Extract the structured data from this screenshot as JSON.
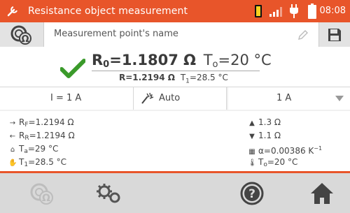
{
  "header": {
    "title": "Resistance object measurement",
    "time": "08:08",
    "accent": "#e8552a"
  },
  "name_bar": {
    "placeholder": "Measurement point's name"
  },
  "result": {
    "r0_symbol": "R",
    "r0_sub": "0",
    "r0_value": "=1.1807 Ω",
    "t0_symbol": "T",
    "t0_sub": "o",
    "t0_value": "=20 °C",
    "r_text": "R=1.2194 Ω",
    "t1_symbol": "T",
    "t1_sub": "1",
    "t1_value": "=28.5 °C",
    "status_icon": "check-icon",
    "status_color": "#3a9a2a"
  },
  "settings": {
    "current": "I = 1 A",
    "mode": "Auto",
    "range": "1 A"
  },
  "params": {
    "rf_sym": "R",
    "rf_sub": "F",
    "rf_val": "=1.2194 Ω",
    "rr_sym": "R",
    "rr_sub": "R",
    "rr_val": "=1.2194 Ω",
    "ta_sym": "T",
    "ta_sub": "a",
    "ta_val": "=29 °C",
    "t1_sym": "T",
    "t1_sub": "1",
    "t1_val": "=28.5 °C",
    "upper_val": "1.3 Ω",
    "lower_val": "1.1 Ω",
    "alpha_val": "α=0.00386 K",
    "alpha_exp": "−1",
    "to_sym": "T",
    "to_sub": "o",
    "to_val": "=20 °C"
  },
  "bottom_nav": [
    "object-icon",
    "settings-icon",
    "help-icon",
    "home-icon"
  ]
}
